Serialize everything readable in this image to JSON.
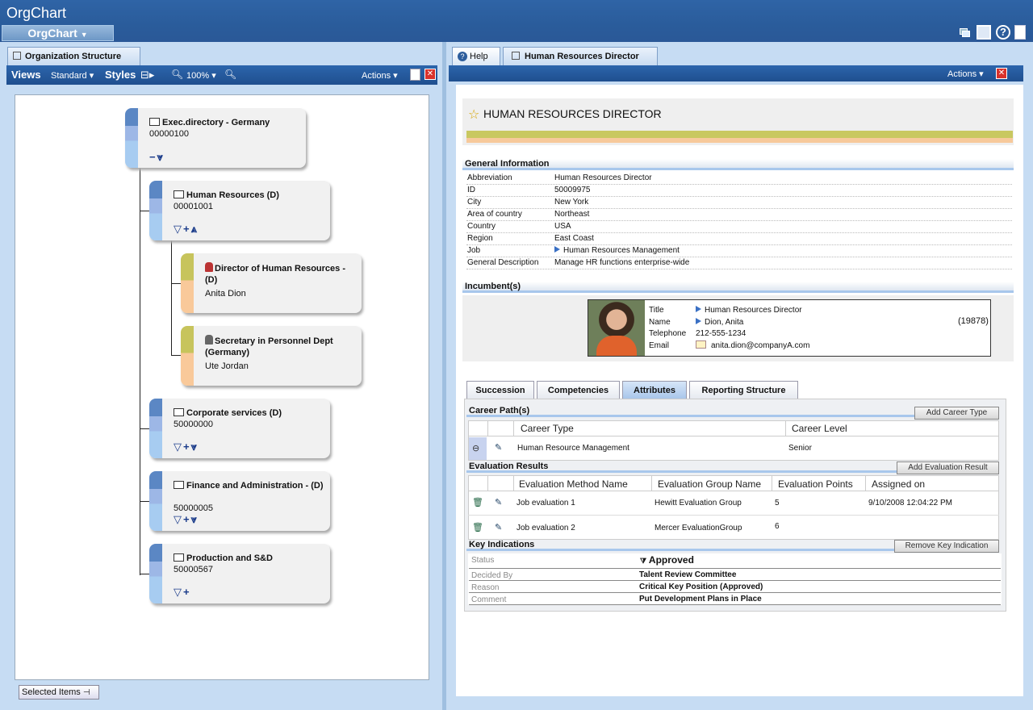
{
  "app": {
    "title": "OrgChart",
    "menu_label": "OrgChart"
  },
  "left": {
    "tab_label": "Organization Structure",
    "views_label": "Views",
    "views_value": "Standard",
    "styles_label": "Styles",
    "zoom": "100%",
    "actions_label": "Actions",
    "selected_items": "Selected Items",
    "nodes": [
      {
        "title": "Exec.directory - Germany",
        "sub": "00000100",
        "ctl": "−⩔"
      },
      {
        "title": "Human Resources (D)",
        "sub": "00001001",
        "ctl": "▽+⩓"
      },
      {
        "title": "Director of Human Resources - (D)",
        "sub": "Anita Dion",
        "ctl": ""
      },
      {
        "title": "Secretary in Personnel Dept (Germany)",
        "sub": "Ute Jordan",
        "ctl": ""
      },
      {
        "title": "Corporate services (D)",
        "sub": "50000000",
        "ctl": "▽+⩔"
      },
      {
        "title": "Finance and Administration - (D)",
        "sub": "50000005",
        "ctl": "▽+⩔"
      },
      {
        "title": "Production and S&D",
        "sub": "50000567",
        "ctl": "▽+"
      }
    ]
  },
  "right": {
    "tabs": [
      "Help",
      "Human Resources Director"
    ],
    "actions_label": "Actions",
    "heading": "HUMAN RESOURCES DIRECTOR",
    "general_info_title": "General Information",
    "general_info": [
      {
        "k": "Abbreviation",
        "v": "Human Resources Director"
      },
      {
        "k": "ID",
        "v": "50009975"
      },
      {
        "k": "City",
        "v": "New York"
      },
      {
        "k": "Area of country",
        "v": "Northeast"
      },
      {
        "k": "Country",
        "v": "USA"
      },
      {
        "k": "Region",
        "v": "East Coast"
      },
      {
        "k": "Job",
        "v": "Human Resources Management"
      },
      {
        "k": "General Description",
        "v": "Manage HR functions enterprise-wide"
      }
    ],
    "incumbents_title": "Incumbent(s)",
    "incumbent": {
      "labels": [
        "Title",
        "Name",
        "Telephone",
        "Email"
      ],
      "title": "Human Resources Director",
      "name": "Dion, Anita",
      "telephone": "212-555-1234",
      "email": "anita.dion@companyA.com",
      "count": "(19878)"
    },
    "detail_tabs": [
      "Succession",
      "Competencies",
      "Attributes",
      "Reporting Structure"
    ],
    "career": {
      "title": "Career Path(s)",
      "button": "Add Career Type",
      "headers": [
        "Career Type",
        "Career Level"
      ],
      "rows": [
        {
          "type": "Human Resource Management",
          "level": "Senior"
        }
      ]
    },
    "evaluation": {
      "title": "Evaluation Results",
      "button": "Add Evaluation Result",
      "headers": [
        "Evaluation Method Name",
        "Evaluation Group Name",
        "Evaluation Points",
        "Assigned on"
      ],
      "rows": [
        {
          "method": "Job evaluation 1",
          "group": "Hewitt Evaluation Group",
          "points": "5",
          "assigned": "9/10/2008 12:04:22 PM"
        },
        {
          "method": "Job evaluation 2",
          "group": "Mercer EvaluationGroup",
          "points": "6",
          "assigned": ""
        }
      ]
    },
    "key": {
      "title": "Key Indications",
      "button": "Remove Key Indication",
      "rows": [
        {
          "k": "Status",
          "v": "Approved"
        },
        {
          "k": "Decided By",
          "v": "Talent Review Committee"
        },
        {
          "k": "Reason",
          "v": "Critical Key Position (Approved)"
        },
        {
          "k": "Comment",
          "v": "Put Development Plans in Place"
        }
      ]
    }
  }
}
